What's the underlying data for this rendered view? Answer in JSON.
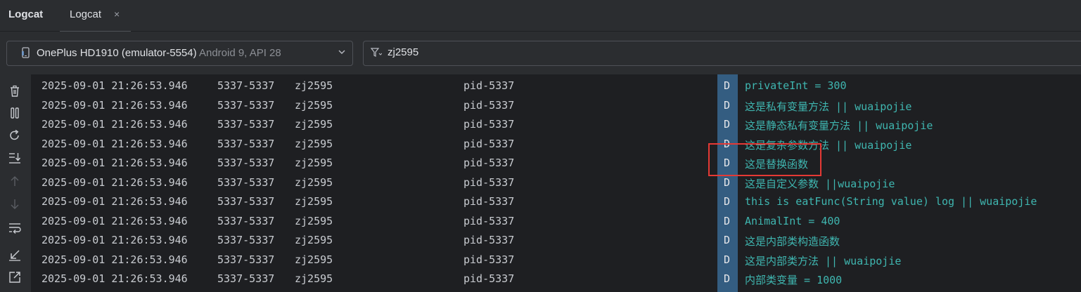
{
  "window": {
    "title": "Logcat"
  },
  "tabs": [
    {
      "label": "Logcat",
      "close": "×"
    }
  ],
  "device": {
    "name": "OnePlus HD1910 (emulator-5554)",
    "api": "Android 9, API 28"
  },
  "filter": {
    "query": "zj2595"
  },
  "sidebar": {
    "icons": [
      "trash-icon",
      "pause-icon",
      "restart-icon",
      "scroll-to-end-icon",
      "up-arrow-icon",
      "down-arrow-icon",
      "soft-wrap-icon",
      "collapse-icon",
      "expand-icon"
    ]
  },
  "colors": {
    "message": "#3fb6b0",
    "level_badge": "#345d81",
    "highlight_box": "#e53935"
  },
  "log": [
    {
      "time": "2025-09-01 21:26:53.946",
      "pid": "5337-5337",
      "tag": "zj2595",
      "process": "pid-5337",
      "level": "D",
      "message": "privateInt = 300"
    },
    {
      "time": "2025-09-01 21:26:53.946",
      "pid": "5337-5337",
      "tag": "zj2595",
      "process": "pid-5337",
      "level": "D",
      "message": "这是私有变量方法 || wuaipojie"
    },
    {
      "time": "2025-09-01 21:26:53.946",
      "pid": "5337-5337",
      "tag": "zj2595",
      "process": "pid-5337",
      "level": "D",
      "message": "这是静态私有变量方法 || wuaipojie"
    },
    {
      "time": "2025-09-01 21:26:53.946",
      "pid": "5337-5337",
      "tag": "zj2595",
      "process": "pid-5337",
      "level": "D",
      "message": "这是复杂参数方法 || wuaipojie"
    },
    {
      "time": "2025-09-01 21:26:53.946",
      "pid": "5337-5337",
      "tag": "zj2595",
      "process": "pid-5337",
      "level": "D",
      "message": "这是替换函数"
    },
    {
      "time": "2025-09-01 21:26:53.946",
      "pid": "5337-5337",
      "tag": "zj2595",
      "process": "pid-5337",
      "level": "D",
      "message": "这是自定义参数 ||wuaipojie"
    },
    {
      "time": "2025-09-01 21:26:53.946",
      "pid": "5337-5337",
      "tag": "zj2595",
      "process": "pid-5337",
      "level": "D",
      "message": "this is eatFunc(String value) log || wuaipojie"
    },
    {
      "time": "2025-09-01 21:26:53.946",
      "pid": "5337-5337",
      "tag": "zj2595",
      "process": "pid-5337",
      "level": "D",
      "message": "AnimalInt =  400"
    },
    {
      "time": "2025-09-01 21:26:53.946",
      "pid": "5337-5337",
      "tag": "zj2595",
      "process": "pid-5337",
      "level": "D",
      "message": "这是内部类构造函数"
    },
    {
      "time": "2025-09-01 21:26:53.946",
      "pid": "5337-5337",
      "tag": "zj2595",
      "process": "pid-5337",
      "level": "D",
      "message": "这是内部类方法 || wuaipojie"
    },
    {
      "time": "2025-09-01 21:26:53.946",
      "pid": "5337-5337",
      "tag": "zj2595",
      "process": "pid-5337",
      "level": "D",
      "message": "内部类变量 = 1000"
    }
  ]
}
